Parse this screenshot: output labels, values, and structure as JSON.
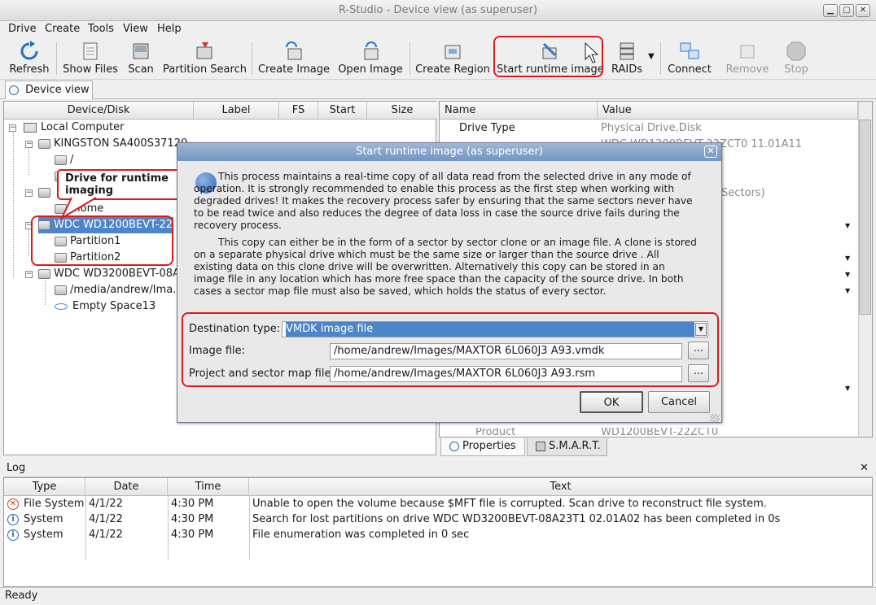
{
  "window": {
    "title": "R-Studio - Device view (as superuser)"
  },
  "menu": [
    "Drive",
    "Create",
    "Tools",
    "View",
    "Help"
  ],
  "toolbar": {
    "refresh": "Refresh",
    "show_files": "Show Files",
    "scan": "Scan",
    "partition_search": "Partition Search",
    "create_image": "Create Image",
    "open_image": "Open Image",
    "create_region": "Create Region",
    "start_runtime_image": "Start runtime image",
    "raids": "RAIDs",
    "connect": "Connect",
    "remove": "Remove",
    "stop": "Stop"
  },
  "tab": {
    "device_view": "Device view"
  },
  "device_table": {
    "columns": [
      "Device/Disk",
      "Label",
      "FS",
      "Start",
      "Size"
    ],
    "rows": {
      "local_computer": "Local Computer",
      "kingston": "KINGSTON SA400S37120",
      "root": "/",
      "home": "/home",
      "wdc1": "WDC WD1200BEVT-222",
      "part1": "Partition1",
      "part2": "Partition2",
      "wdc2": "WDC WD3200BEVT-08A2",
      "media": "/media/andrew/Ima...",
      "empty": "Empty Space13"
    }
  },
  "callout": {
    "text": "Drive for runtime imaging"
  },
  "props_table": {
    "columns": [
      "Name",
      "Value"
    ],
    "drive_type_name": "Drive Type",
    "drive_type_value": "Physical Drive,Disk",
    "partial_value": "WDC WD1200BEVT-22ZCT0 11.01A11",
    "partial_sectors": "Sectors)",
    "product_name": "Product",
    "product_value": "WD1200BEVT-22ZCT0"
  },
  "props_tabs": {
    "properties": "Properties",
    "smart": "S.M.A.R.T."
  },
  "dialog": {
    "title": "Start runtime image (as superuser)",
    "para1": "This process maintains a real-time copy of all data read from the selected drive in any mode of operation. It is strongly recommended to enable this process as the first step when working with degraded drives! It makes the recovery process safer by ensuring that the same sectors never have to be read twice and also reduces the degree of data loss in case the source drive fails during the recovery process.",
    "para2": "This copy can either be in the form of a sector by sector clone or an image file. A clone is stored on a separate physical drive which must be the same size or larger than the source drive . All existing data on this clone drive will be overwritten. Alternatively this copy can be stored in an image file in any location which has more free space than the capacity of the source drive. In both cases a sector map file must also be saved, which holds the status of every sector.",
    "destination_label": "Destination type:",
    "destination_value": "VMDK image file",
    "image_file_label": "Image file:",
    "image_file_value": "/home/andrew/Images/MAXTOR 6L060J3 A93.vmdk",
    "map_file_label": "Project and sector map file:",
    "map_file_value": "/home/andrew/Images/MAXTOR 6L060J3 A93.rsm",
    "browse": "...",
    "ok": "OK",
    "cancel": "Cancel"
  },
  "log": {
    "title": "Log",
    "columns": [
      "Type",
      "Date",
      "Time",
      "Text"
    ],
    "rows": [
      {
        "type": "File System",
        "date": "4/1/22",
        "time": "4:30 PM",
        "text": "Unable to open the volume because $MFT file is corrupted. Scan drive to reconstruct file system.",
        "icon": "error-icon"
      },
      {
        "type": "System",
        "date": "4/1/22",
        "time": "4:30 PM",
        "text": "Search for lost partitions on drive WDC WD3200BEVT-08A23T1 02.01A02 has been completed in 0s",
        "icon": "info-icon"
      },
      {
        "type": "System",
        "date": "4/1/22",
        "time": "4:30 PM",
        "text": "File enumeration was completed in 0 sec",
        "icon": "info-icon"
      }
    ]
  },
  "status": {
    "text": "Ready"
  },
  "colors": {
    "highlight": "#e01818",
    "selection": "#4d86c8",
    "dialog_title": "#7f9fc8"
  }
}
